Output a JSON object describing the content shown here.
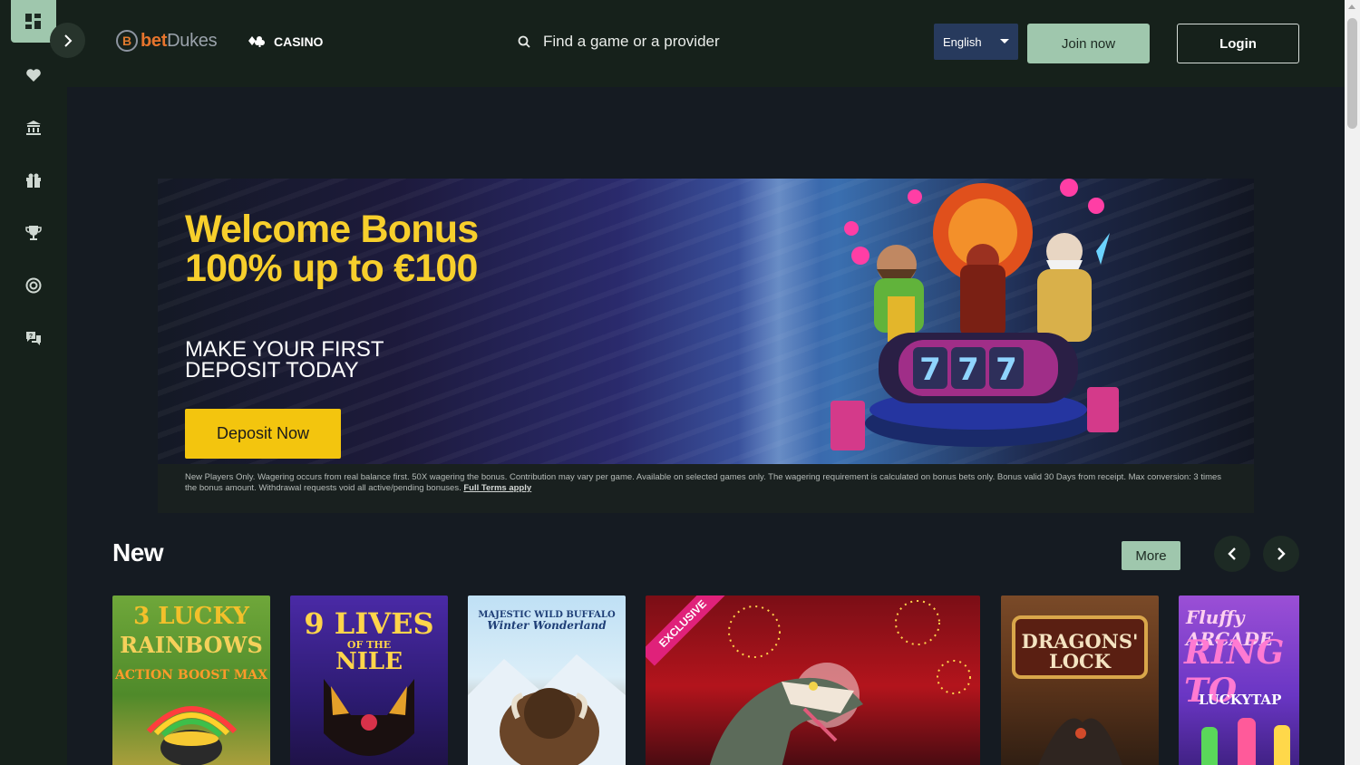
{
  "header": {
    "logo_bet": "bet",
    "logo_dukes": "Dukes",
    "casino_label": "CASINO",
    "search_placeholder": "Find a game or a provider",
    "language": "English",
    "join_label": "Join now",
    "login_label": "Login"
  },
  "sidebar": {
    "items": [
      {
        "icon": "dashboard-icon"
      },
      {
        "icon": "heart-icon"
      },
      {
        "icon": "bank-icon"
      },
      {
        "icon": "gift-icon"
      },
      {
        "icon": "trophy-icon"
      },
      {
        "icon": "target-icon"
      },
      {
        "icon": "support-chat-icon"
      }
    ]
  },
  "banner": {
    "title": "Welcome Bonus 100% up to €100",
    "subtitle": "MAKE YOUR FIRST DEPOSIT TODAY",
    "cta": "Deposit Now",
    "terms": "New Players Only. Wagering occurs from real balance first. 50X wagering the bonus. Contribution may vary per game. Available on selected games only. The wagering requirement is calculated on bonus bets only. Bonus valid 30 Days from receipt. Max conversion: 3 times the bonus amount. Withdrawal requests void all active/pending bonuses.",
    "terms_link": "Full Terms apply"
  },
  "new_section": {
    "title": "New",
    "more_label": "More",
    "games": [
      {
        "title_line1": "3 LUCKY",
        "title_line2": "RAINBOWS",
        "title_line3": "ACTION BOOST MAX"
      },
      {
        "title_line1": "9 LIVES",
        "title_line2": "OF THE",
        "title_line3": "NILE"
      },
      {
        "title_line1": "MAJESTIC WILD BUFFALO",
        "title_line2": "Winter Wonderland"
      },
      {
        "badge": "EXCLUSIVE"
      },
      {
        "title_line1": "DRAGONS'",
        "title_line2": "LOCK"
      },
      {
        "title_line1": "Fluffy ARCADE",
        "title_line2": "RING TO",
        "title_line3": "LUCKYTAP"
      }
    ]
  },
  "colors": {
    "accent_green": "#9fc7ad",
    "cta_yellow": "#f3c50e",
    "title_yellow": "#f7cf2c",
    "language_blue": "#273a5d"
  }
}
